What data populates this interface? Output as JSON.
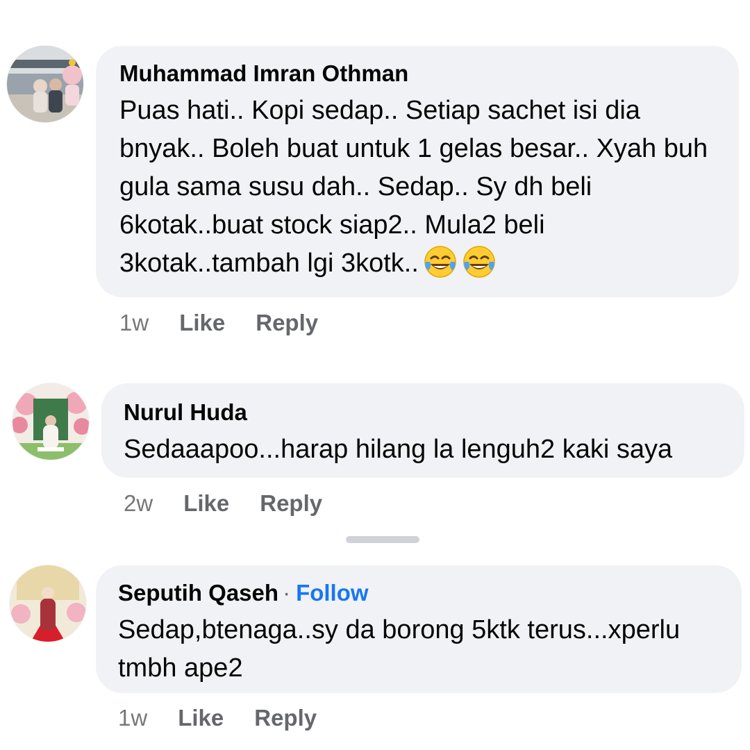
{
  "comments": [
    {
      "author": "Muhammad Imran Othman",
      "text": "Puas hati.. Kopi sedap.. Setiap sachet isi dia bnyak.. Boleh buat untuk 1 gelas besar.. Xyah buh gula sama susu dah.. Sedap.. Sy dh beli 6kotak..buat stock siap2.. Mula2 beli 3kotak..tambah lgi 3kotk..",
      "emojis": [
        "face-with-tears-of-joy",
        "face-with-tears-of-joy"
      ],
      "time": "1w",
      "like_label": "Like",
      "reply_label": "Reply"
    },
    {
      "author": "Nurul Huda",
      "text": "Sedaaapoo...harap hilang la lenguh2 kaki saya",
      "time": "2w",
      "like_label": "Like",
      "reply_label": "Reply"
    },
    {
      "author": "Seputih Qaseh",
      "separator": "·",
      "follow_label": "Follow",
      "text": "Sedap,btenaga..sy da borong 5ktk terus...xperlu tmbh ape2",
      "time": "1w",
      "like_label": "Like",
      "reply_label": "Reply"
    }
  ],
  "colors": {
    "bubble": "#f0f2f5",
    "follow": "#1877f2",
    "secondary_text": "#65676b"
  }
}
